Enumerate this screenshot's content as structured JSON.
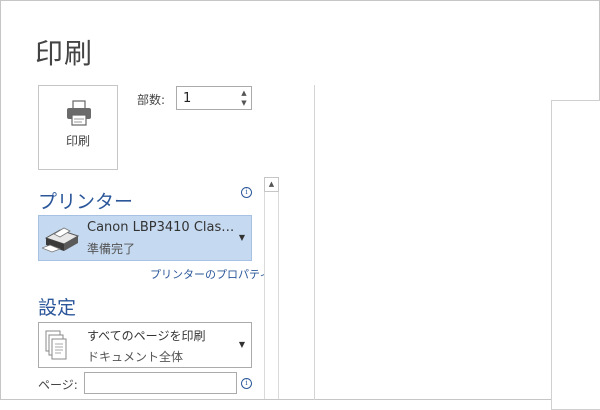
{
  "title": "印刷",
  "print_button": {
    "label": "印刷",
    "icon": "printer-icon"
  },
  "copies": {
    "label": "部数:",
    "value": "1"
  },
  "printer": {
    "heading": "プリンター",
    "name": "Canon LBP3410 Clas…",
    "status": "準備完了",
    "properties_link": "プリンターのプロパティ"
  },
  "settings": {
    "heading": "設定",
    "range_main": "すべてのページを印刷",
    "range_sub": "ドキュメント全体",
    "pages_label": "ページ:",
    "pages_value": ""
  },
  "colors": {
    "accent": "#2b579a",
    "selected_bg": "#c5d9f0"
  }
}
